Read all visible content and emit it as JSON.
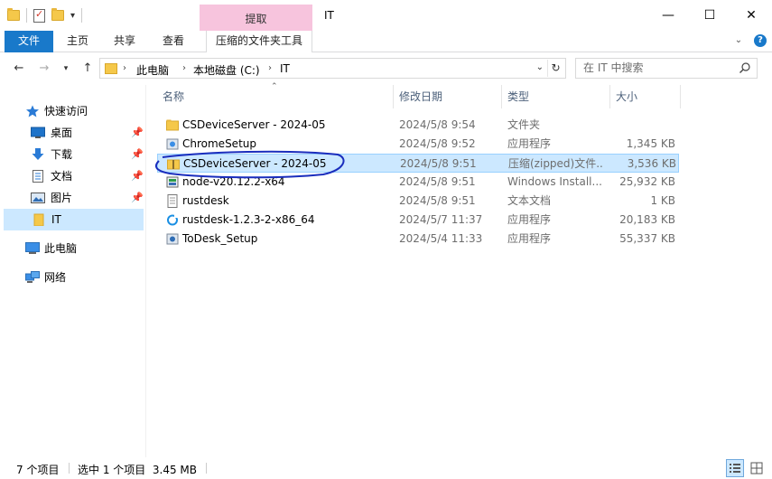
{
  "window": {
    "title": "IT",
    "context_tab": "提取",
    "minimize_glyph": "—",
    "maximize_glyph": "☐",
    "close_glyph": "✕"
  },
  "ribbon": {
    "tabs": [
      {
        "label": "文件"
      },
      {
        "label": "主页"
      },
      {
        "label": "共享"
      },
      {
        "label": "查看"
      },
      {
        "label": "压缩的文件夹工具"
      }
    ],
    "help_glyph": "?",
    "accent_color": "#1979ca",
    "context_color": "#f7c4dd"
  },
  "address": {
    "crumbs": [
      "此电脑",
      "本地磁盘 (C:)",
      "IT"
    ],
    "separator": "›"
  },
  "search": {
    "placeholder": "在 IT 中搜索"
  },
  "nav_pane": {
    "items": [
      {
        "label": "快速访问",
        "icon": "star-icon"
      },
      {
        "label": "桌面",
        "icon": "desktop-icon",
        "pinned": true
      },
      {
        "label": "下载",
        "icon": "download-icon",
        "pinned": true
      },
      {
        "label": "文档",
        "icon": "document-icon",
        "pinned": true
      },
      {
        "label": "图片",
        "icon": "picture-icon",
        "pinned": true
      },
      {
        "label": "IT",
        "icon": "folder-icon",
        "selected": true
      },
      {
        "label": "此电脑",
        "icon": "computer-icon"
      },
      {
        "label": "网络",
        "icon": "network-icon"
      }
    ]
  },
  "columns": {
    "name": "名称",
    "date": "修改日期",
    "type": "类型",
    "size": "大小"
  },
  "files": [
    {
      "name": "CSDeviceServer - 2024-05",
      "date": "2024/5/8 9:54",
      "type": "文件夹",
      "size": "",
      "icon": "folder-icon"
    },
    {
      "name": "ChromeSetup",
      "date": "2024/5/8 9:52",
      "type": "应用程序",
      "size": "1,345 KB",
      "icon": "installer-icon"
    },
    {
      "name": "CSDeviceServer - 2024-05",
      "date": "2024/5/8 9:51",
      "type": "压缩(zipped)文件...",
      "size": "3,536 KB",
      "icon": "zip-folder-icon",
      "selected": true
    },
    {
      "name": "node-v20.12.2-x64",
      "date": "2024/5/8 9:51",
      "type": "Windows Install...",
      "size": "25,932 KB",
      "icon": "msi-icon"
    },
    {
      "name": "rustdesk",
      "date": "2024/5/8 9:51",
      "type": "文本文档",
      "size": "1 KB",
      "icon": "text-file-icon"
    },
    {
      "name": "rustdesk-1.2.3-2-x86_64",
      "date": "2024/5/7 11:37",
      "type": "应用程序",
      "size": "20,183 KB",
      "icon": "rustdesk-icon"
    },
    {
      "name": "ToDesk_Setup",
      "date": "2024/5/4 11:33",
      "type": "应用程序",
      "size": "55,337 KB",
      "icon": "installer-icon"
    }
  ],
  "status": {
    "count": "7 个项目",
    "selection": "选中 1 个项目  3.45 MB"
  }
}
